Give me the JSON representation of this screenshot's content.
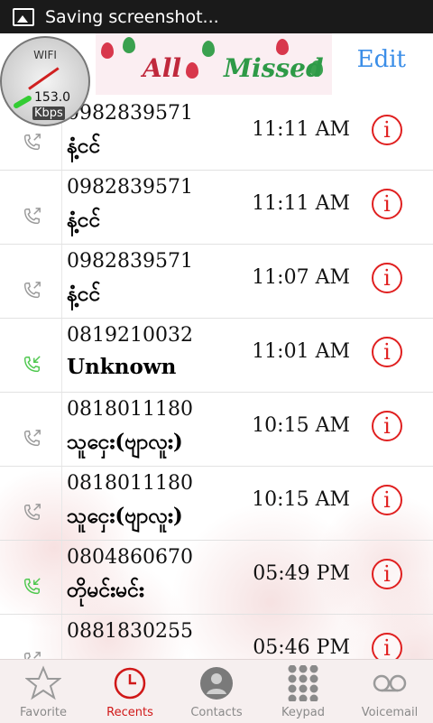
{
  "status_bar": {
    "text": "Saving screenshot..."
  },
  "header": {
    "banner_left": "All",
    "banner_right": "Missed",
    "edit_label": "Edit"
  },
  "speed_widget": {
    "label": "WIFI",
    "value": "153.0",
    "unit": "Kbps"
  },
  "calls": [
    {
      "number": "0982839571",
      "name": "နံ့ငင်",
      "time": "11:11 AM",
      "type": "missed"
    },
    {
      "number": "0982839571",
      "name": "နံ့ငင်",
      "time": "11:11 AM",
      "type": "missed"
    },
    {
      "number": "0982839571",
      "name": "နံ့ငင်",
      "time": "11:07 AM",
      "type": "missed"
    },
    {
      "number": "0819210032",
      "name": "Unknown",
      "time": "11:01 AM",
      "type": "incoming"
    },
    {
      "number": "0818011180",
      "name": "သူငှေး(ဗျာလူး)",
      "time": "10:15 AM",
      "type": "missed"
    },
    {
      "number": "0818011180",
      "name": "သူငှေး(ဗျာလူး)",
      "time": "10:15 AM",
      "type": "missed"
    },
    {
      "number": "0804860670",
      "name": "တိုမင်းမင်း",
      "time": "05:49 PM",
      "type": "incoming"
    },
    {
      "number": "0881830255",
      "name": "",
      "time": "05:46 PM",
      "type": "missed"
    }
  ],
  "tabs": [
    {
      "label": "Favorite",
      "icon": "star-icon",
      "active": false
    },
    {
      "label": "Recents",
      "icon": "clock-icon",
      "active": true
    },
    {
      "label": "Contacts",
      "icon": "person-icon",
      "active": false
    },
    {
      "label": "Keypad",
      "icon": "keypad-icon",
      "active": false
    },
    {
      "label": "Voicemail",
      "icon": "voicemail-icon",
      "active": false
    }
  ],
  "colors": {
    "accent_red": "#e02020",
    "edit_blue": "#3b8ee8",
    "incoming_green": "#4fc84f",
    "missed_gray": "#9a9a9a"
  }
}
